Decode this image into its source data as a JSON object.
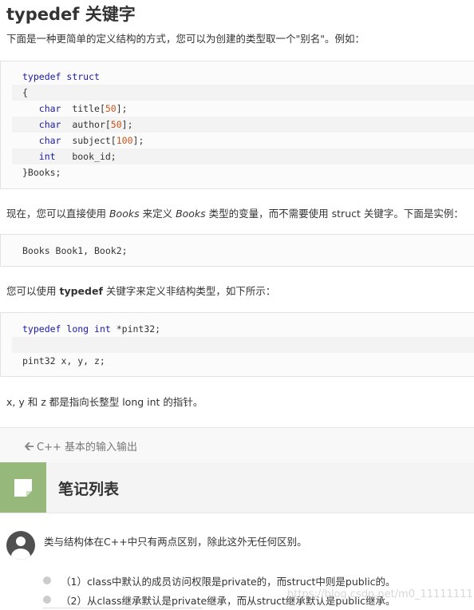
{
  "heading": "typedef 关键字",
  "intro": "下面是一种更简单的定义结构的方式，您可以为创建的类型取一个\"别名\"。例如：",
  "code1": {
    "l1a": "typedef",
    "l1b": " struct",
    "l2": "{",
    "l3a": "char",
    "l3b": "  title[",
    "l3c": "50",
    "l3d": "];",
    "l4a": "char",
    "l4b": "  author[",
    "l4c": "50",
    "l4d": "];",
    "l5a": "char",
    "l5b": "  subject[",
    "l5c": "100",
    "l5d": "];",
    "l6a": "int",
    "l6b": "   book_id;",
    "l7": "}Books;"
  },
  "para2": {
    "a": "现在，您可以直接使用 ",
    "b": "Books",
    "c": " 来定义 ",
    "d": "Books",
    "e": " 类型的变量，而不需要使用 struct 关键字。下面是实例："
  },
  "code2": {
    "l1": "Books Book1, Book2;"
  },
  "para3": {
    "a": "您可以使用 ",
    "b": "typedef",
    "c": " 关键字来定义非结构类型，如下所示："
  },
  "code3": {
    "l1a": "typedef",
    "l1b": " long",
    "l1c": " int",
    "l1d": " *pint32;",
    "l3": "pint32 x, y, z;"
  },
  "para4": "x, y 和 z 都是指向长整型 long int 的指针。",
  "prev_link": "C++ 基本的输入输出",
  "notes": {
    "title": "笔记列表",
    "text": "类与结构体在C++中只有两点区别，除此这外无任何区别。",
    "items": [
      "（1）class中默认的成员访问权限是private的，而struct中则是public的。",
      "（2）从class继承默认是private继承，而从struct继承默认是public继承。"
    ]
  },
  "watermark": "https://blog.csdn.net/m0_11111111",
  "colors": {
    "accent_green": "#96b97b",
    "keyword_blue": "#1a1aa6",
    "number_orange": "#c5541b"
  }
}
